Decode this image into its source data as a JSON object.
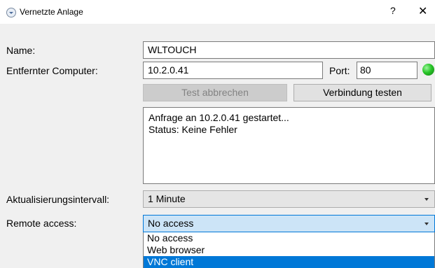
{
  "window": {
    "title": "Vernetzte Anlage",
    "help_symbol": "?",
    "close_symbol": "✕"
  },
  "form": {
    "name_label": "Name:",
    "name_value": "WLTOUCH",
    "computer_label": "Entfernter Computer:",
    "computer_value": "10.2.0.41",
    "port_label": "Port:",
    "port_value": "80",
    "status_led": "green"
  },
  "buttons": {
    "cancel_test": "Test abbrechen",
    "test_connection": "Verbindung testen"
  },
  "status": {
    "lines": [
      "Anfrage an 10.2.0.41 gestartet...",
      "Status: Keine Fehler"
    ]
  },
  "update_interval": {
    "label": "Aktualisierungsintervall:",
    "value": "1 Minute"
  },
  "remote_access": {
    "label": "Remote access:",
    "value": "No access",
    "options": [
      "No access",
      "Web browser",
      "VNC client"
    ],
    "highlighted_option": "VNC client"
  },
  "colors": {
    "highlight": "#0078d7",
    "select_focus": "#cce4f7",
    "led": "#28c628"
  }
}
